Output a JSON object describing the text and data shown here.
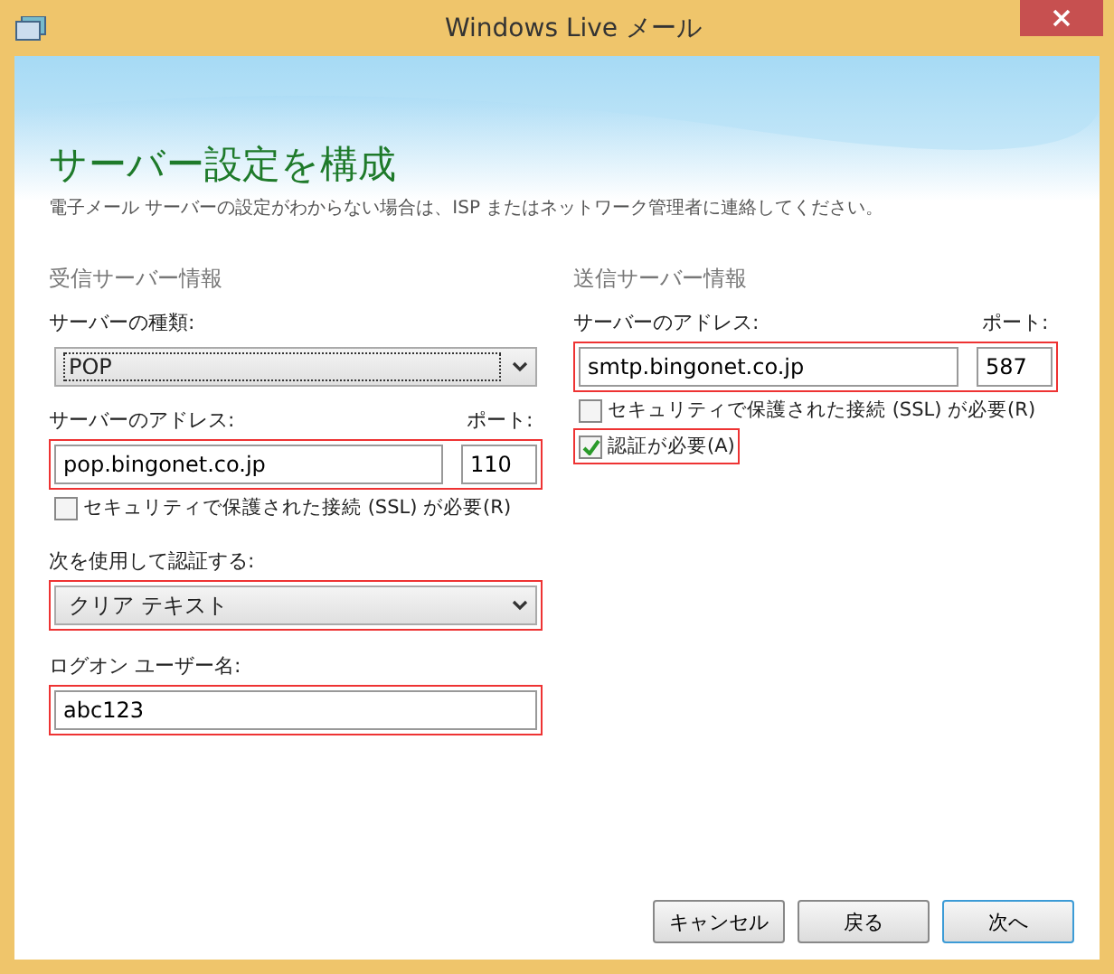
{
  "window": {
    "title": "Windows Live メール"
  },
  "heading": "サーバー設定を構成",
  "subtitle": "電子メール サーバーの設定がわからない場合は、ISP またはネットワーク管理者に連絡してください。",
  "incoming": {
    "section": "受信サーバー情報",
    "server_type": {
      "label": "サーバーの種類:",
      "value": "POP",
      "focused": true
    },
    "address": {
      "label": "サーバーのアドレス:",
      "value": "pop.bingonet.co.jp",
      "port_label": "ポート:",
      "port": "110",
      "highlighted": true
    },
    "ssl": {
      "label": "セキュリティで保護された接続 (SSL) が必要(R)",
      "checked": false,
      "highlighted": false
    },
    "auth": {
      "label": "次を使用して認証する:",
      "value": "クリア テキスト",
      "highlighted": true
    },
    "logon": {
      "label": "ログオン ユーザー名:",
      "value": "abc123",
      "highlighted": true
    }
  },
  "outgoing": {
    "section": "送信サーバー情報",
    "address": {
      "label": "サーバーのアドレス:",
      "value": "smtp.bingonet.co.jp",
      "port_label": "ポート:",
      "port": "587",
      "highlighted": true
    },
    "checks": [
      {
        "label": "セキュリティで保護された接続 (SSL) が必要(R)",
        "checked": false,
        "highlighted": false
      },
      {
        "label": "認証が必要(A)",
        "checked": true,
        "highlighted": true
      }
    ]
  },
  "buttons": [
    {
      "label": "キャンセル",
      "default": false
    },
    {
      "label": "戻る",
      "default": false
    },
    {
      "label": "次へ",
      "default": true
    }
  ]
}
